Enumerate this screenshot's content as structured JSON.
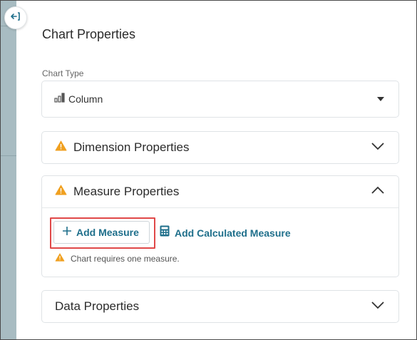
{
  "panel": {
    "title": "Chart Properties"
  },
  "chart_type": {
    "label": "Chart Type",
    "value": "Column",
    "icon": "column-chart-icon"
  },
  "sections": {
    "dimension": {
      "title": "Dimension Properties",
      "warning": true,
      "expanded": false
    },
    "measure": {
      "title": "Measure Properties",
      "warning": true,
      "expanded": true,
      "add_measure_label": "Add Measure",
      "add_calculated_label": "Add Calculated Measure",
      "requirement_message": "Chart requires one measure."
    },
    "data": {
      "title": "Data Properties",
      "expanded": false
    }
  },
  "colors": {
    "accent": "#1f6f8b",
    "warning": "#f0a020",
    "highlight": "#e04848",
    "strip": "#a8bcc2"
  }
}
